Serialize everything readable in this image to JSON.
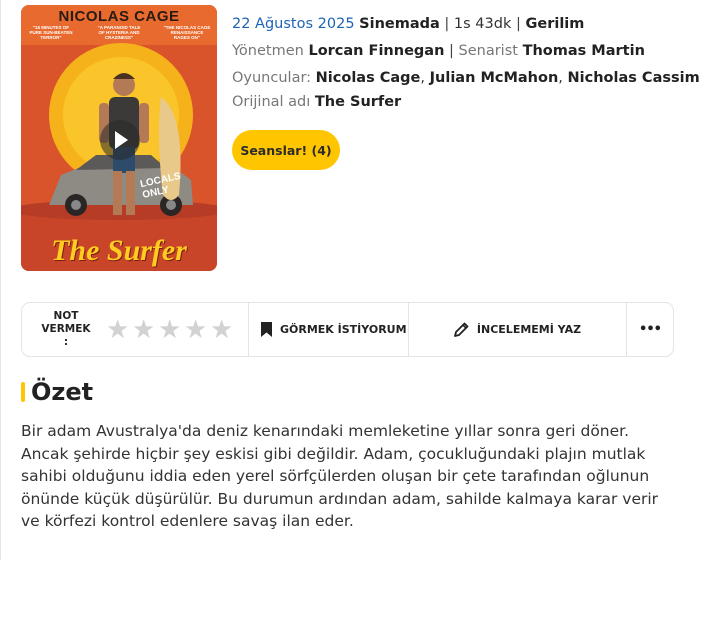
{
  "poster": {
    "top_text": "NICOLAS CAGE",
    "title": "The Surfer",
    "quote_left": "\"15 MINUTES OF PURE SUN-BEATEN TERROR\"",
    "quote_middle": "\"A PARANOID TALE OF HYSTERIA AND CRAZINESS\"",
    "quote_right": "\"THE NICOLAS CAGE RENAISSANCE RAGES ON\"",
    "car_graffiti": "LOCALS ONLY"
  },
  "info": {
    "date": "22 Ağustos 2025",
    "status": "Sinemada",
    "separator": "|",
    "duration": "1s 43dk",
    "genre": "Gerilim",
    "director_label": "Yönetmen",
    "director": "Lorcan Finnegan",
    "writer_label": "Senarist",
    "writer": "Thomas Martin",
    "cast_label": "Oyuncular:",
    "cast": [
      "Nicolas Cage",
      "Julian McMahon",
      "Nicholas Cassim"
    ],
    "cast_sep": ",",
    "original_label": "Orijinal adı",
    "original_title": "The Surfer"
  },
  "showtimes_button": "Seanslar! (4)",
  "actions": {
    "rate_label_1": "NOT",
    "rate_label_2": "VERMEK :",
    "star_glyph": "★",
    "rating": 0,
    "star_count": 5,
    "want_to_see": "GÖRMEK İSTİYORUM",
    "write_review": "İNCELEMEMİ YAZ",
    "more": "•••"
  },
  "summary": {
    "title": "Özet",
    "text": "Bir adam Avustralya'da deniz kenarındaki memleketine yıllar sonra geri döner. Ancak şehirde hiçbir şey eskisi gibi değildir. Adam, çocukluğundaki plajın mutlak sahibi olduğunu iddia eden yerel sörfçülerden oluşan bir çete tarafından oğlunun önünde küçük düşürülür. Bu durumun ardından adam, sahilde kalmaya karar verir ve körfezi kontrol edenlere savaş ilan eder."
  },
  "colors": {
    "accent": "#ffc600",
    "date": "#1e64b4",
    "star_empty": "#d2d2d2"
  }
}
